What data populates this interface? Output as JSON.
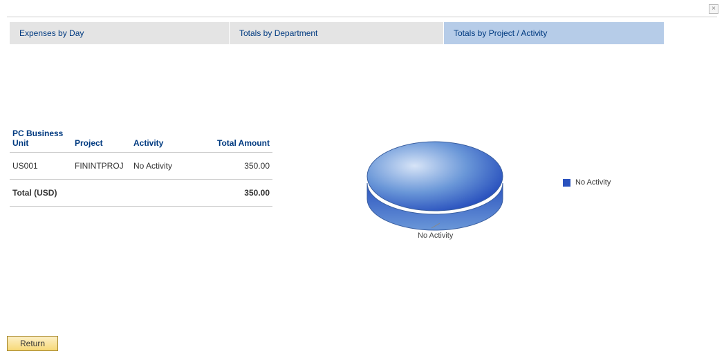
{
  "close_label": "×",
  "tabs": [
    {
      "label": "Expenses by Day",
      "active": false
    },
    {
      "label": "Totals by Department",
      "active": false
    },
    {
      "label": "Totals by Project / Activity",
      "active": true
    }
  ],
  "table": {
    "headers": {
      "bu": "PC Business Unit",
      "project": "Project",
      "activity": "Activity",
      "amount": "Total Amount"
    },
    "rows": [
      {
        "bu": "US001",
        "project": "FININTPROJ",
        "activity": "No Activity",
        "amount": "350.00"
      }
    ],
    "total_label": "Total (USD)",
    "total_amount": "350.00"
  },
  "chart_data": {
    "type": "pie",
    "title": "",
    "series": [
      {
        "name": "No Activity",
        "value": 350.0
      }
    ],
    "slice_label": "No Activity",
    "legend_label": "No Activity"
  },
  "return_label": "Return"
}
